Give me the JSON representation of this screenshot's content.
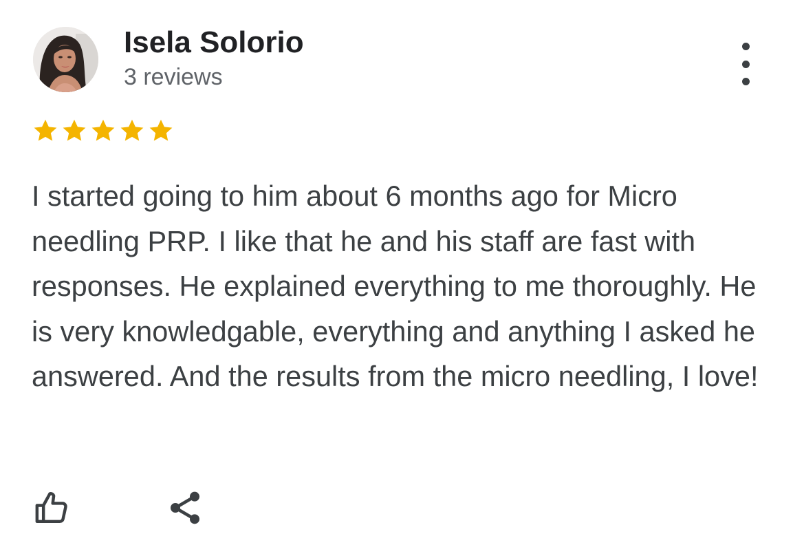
{
  "reviewer": {
    "name": "Isela Solorio",
    "review_count_text": "3 reviews",
    "avatar_icon": "profile-photo"
  },
  "rating": {
    "value": 5,
    "max": 5,
    "star_color": "#F4B400"
  },
  "review": {
    "text": "I started going to him about 6 months ago for Micro needling PRP. I like that he and his staff are fast with responses. He explained everything to me thoroughly. He is very knowledgable, everything and anything I asked he answered. And the results from the micro needling, I love!"
  },
  "actions": {
    "like_icon": "thumbs-up-icon",
    "share_icon": "share-icon",
    "more_icon": "more-vert-icon"
  },
  "colors": {
    "name": "#202124",
    "secondary_text": "#5f6368",
    "body_text": "#3c4043",
    "icon": "#3c4043"
  }
}
